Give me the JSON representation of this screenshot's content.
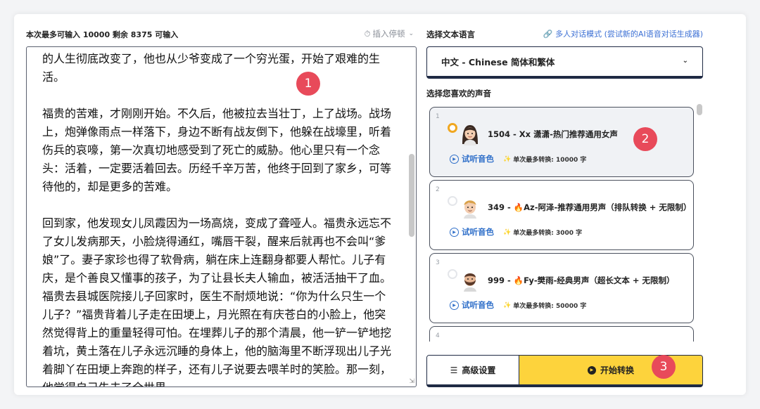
{
  "editor": {
    "char_count_text": "本次最多可输入 10000 剩余 8375 可输入",
    "pause_label": "插入停顿",
    "paragraphs": [
      "的人生彻底改变了，他也从少爷变成了一个穷光蛋，开始了艰难的生活。",
      "福贵的苦难，才刚刚开始。不久后，他被拉去当壮丁，上了战场。战场上，炮弹像雨点一样落下，身边不断有战友倒下，他躲在战壕里，听着伤兵的哀嚎，第一次真切地感受到了死亡的威胁。他心里只有一个念头：活着，一定要活着回去。历经千辛万苦，他终于回到了家乡，可等待他的，却是更多的苦难。",
      "回到家，他发现女儿凤霞因为一场高烧，变成了聋哑人。福贵永远忘不了女儿发病那天，小脸烧得通红，嘴唇干裂，醒来后就再也不会叫“爹娘”了。妻子家珍也得了软骨病，躺在床上连翻身都要人帮忙。儿子有庆，是个善良又懂事的孩子，为了让县长夫人输血，被活活抽干了血。福贵去县城医院接儿子回家时，医生不耐烦地说：“你为什么只生一个儿子？”福贵背着儿子走在田埂上，月光照在有庆苍白的小脸上，他突然觉得背上的重量轻得可怕。在埋葬儿子的那个清晨，他一铲一铲地挖着坑，黄土落在儿子永远沉睡的身体上，他的脑海里不断浮现出儿子光着脚丫在田埂上奔跑的样子，还有儿子说要去喂羊时的笑脸。那一刻，他觉得自己失去了全世界。"
    ]
  },
  "badges": {
    "one": "1",
    "two": "2",
    "three": "3"
  },
  "language": {
    "label": "选择文本语言",
    "multi_link": "多人对话模式 (尝试新的AI语音对话生成器)",
    "selected": "中文 - Chinese 简体和繁体"
  },
  "voices": {
    "label": "选择您喜欢的声音",
    "items": [
      {
        "index": "1",
        "name": "1504 - Xx 潇潇-热门推荐通用女声",
        "listen": "试听音色",
        "limit": "单次最多转换: 10000 字"
      },
      {
        "index": "2",
        "name": "349 - 🔥Az-阿泽-推荐通用男声（排队转换 + 无限制）",
        "listen": "试听音色",
        "limit": "单次最多转换: 3000 字"
      },
      {
        "index": "3",
        "name": "999 - 🔥Fy-樊雨-经典男声（超长文本 + 无限制）",
        "listen": "试听音色",
        "limit": "单次最多转换: 50000 字"
      },
      {
        "index": "4"
      }
    ]
  },
  "actions": {
    "advanced": "高级设置",
    "start": "开始转换"
  },
  "colors": {
    "accent": "#fdd33c",
    "badge": "#e84a5a",
    "link": "#2f6fc9"
  }
}
